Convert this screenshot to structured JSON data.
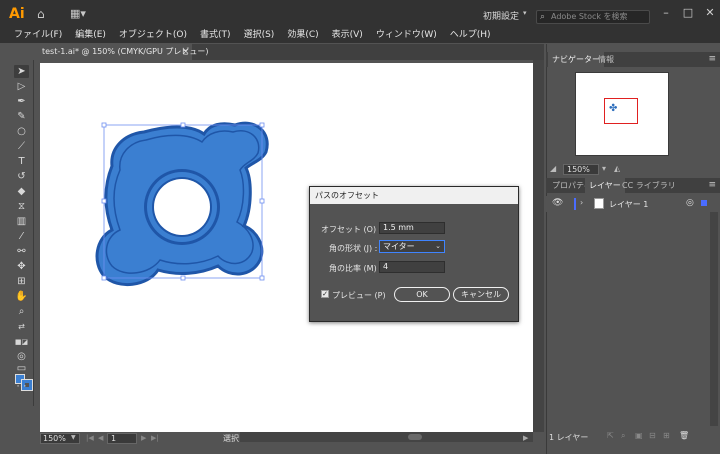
{
  "app": {
    "logo": "Ai",
    "workspace": "初期設定",
    "stock_search_placeholder": "Adobe Stock を検索"
  },
  "menu": [
    "ファイル(F)",
    "編集(E)",
    "オブジェクト(O)",
    "書式(T)",
    "選択(S)",
    "効果(C)",
    "表示(V)",
    "ウィンドウ(W)",
    "ヘルプ(H)"
  ],
  "document_tab": {
    "title": "test-1.ai* @ 150% (CMYK/GPU プレビュー)",
    "close": "×"
  },
  "status_bar": {
    "zoom": "150%",
    "page": "1",
    "tool": "選択"
  },
  "right_panel": {
    "top_tabs": [
      "ナビゲーター",
      "情報"
    ],
    "nav_zoom": "150%",
    "layer_tabs": [
      "プロパティ",
      "レイヤー",
      "CC ライブラリ"
    ],
    "layer_name": "レイヤー 1",
    "layer_count": "1 レイヤー"
  },
  "dialog": {
    "title": "パスのオフセット",
    "offset_label": "オフセット (O) :",
    "offset_value": "1.5 mm",
    "joins_label": "角の形状 (J) :",
    "joins_value": "マイター",
    "miter_label": "角の比率 (M) :",
    "miter_value": "4",
    "preview_label": "プレビュー (P)",
    "preview_checked": true,
    "ok": "OK",
    "cancel": "キャンセル"
  },
  "colors": {
    "shape_fill": "#3b7fd1",
    "shape_stroke": "#1f56a8",
    "accent": "#3f84ff"
  }
}
